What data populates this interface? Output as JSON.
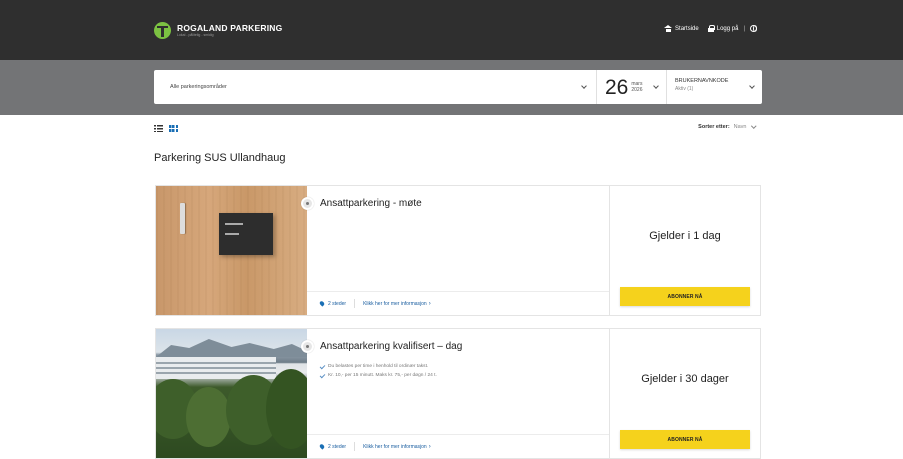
{
  "header": {
    "brand_name": "ROGALAND PARKERING",
    "brand_sub": "Lokal - pålitelig - smidig",
    "nav": {
      "home": "Startside",
      "login": "Logg på",
      "separator": "|"
    }
  },
  "filters": {
    "area_placeholder": "Alle parkeringsområder",
    "date": {
      "day": "26",
      "month": "mars",
      "year": "2026"
    },
    "user": {
      "code": "BRUKERNAVNKODE",
      "status": "Aktiv (1)"
    }
  },
  "toolbar": {
    "sort_label": "Sorter etter:",
    "sort_value": "Navn"
  },
  "section_title": "Parkering SUS Ullandhaug",
  "cards": [
    {
      "title": "Ansattparkering - møte",
      "bullets": [],
      "locations": "2 steder",
      "more_info": "Klikk her for mer informasjon",
      "validity": "Gjelder i 1 dag",
      "button": "ABONNER NÅ"
    },
    {
      "title": "Ansattparkering kvalifisert – dag",
      "bullets": [
        "Du belastes per time i henhold til ordinær takst.",
        "Kr. 10,- per 15 minutt. Maks kr. 75,- per døgn / 24 t."
      ],
      "locations": "2 steder",
      "more_info": "Klikk her for mer informasjon",
      "validity": "Gjelder i 30 dager",
      "button": "ABONNER NÅ"
    }
  ],
  "colors": {
    "header_bg": "#2f2f2f",
    "filter_band_bg": "#737476",
    "brand_green": "#7cc242",
    "button_yellow": "#f5d21c",
    "link_blue": "#1a5ea0"
  }
}
